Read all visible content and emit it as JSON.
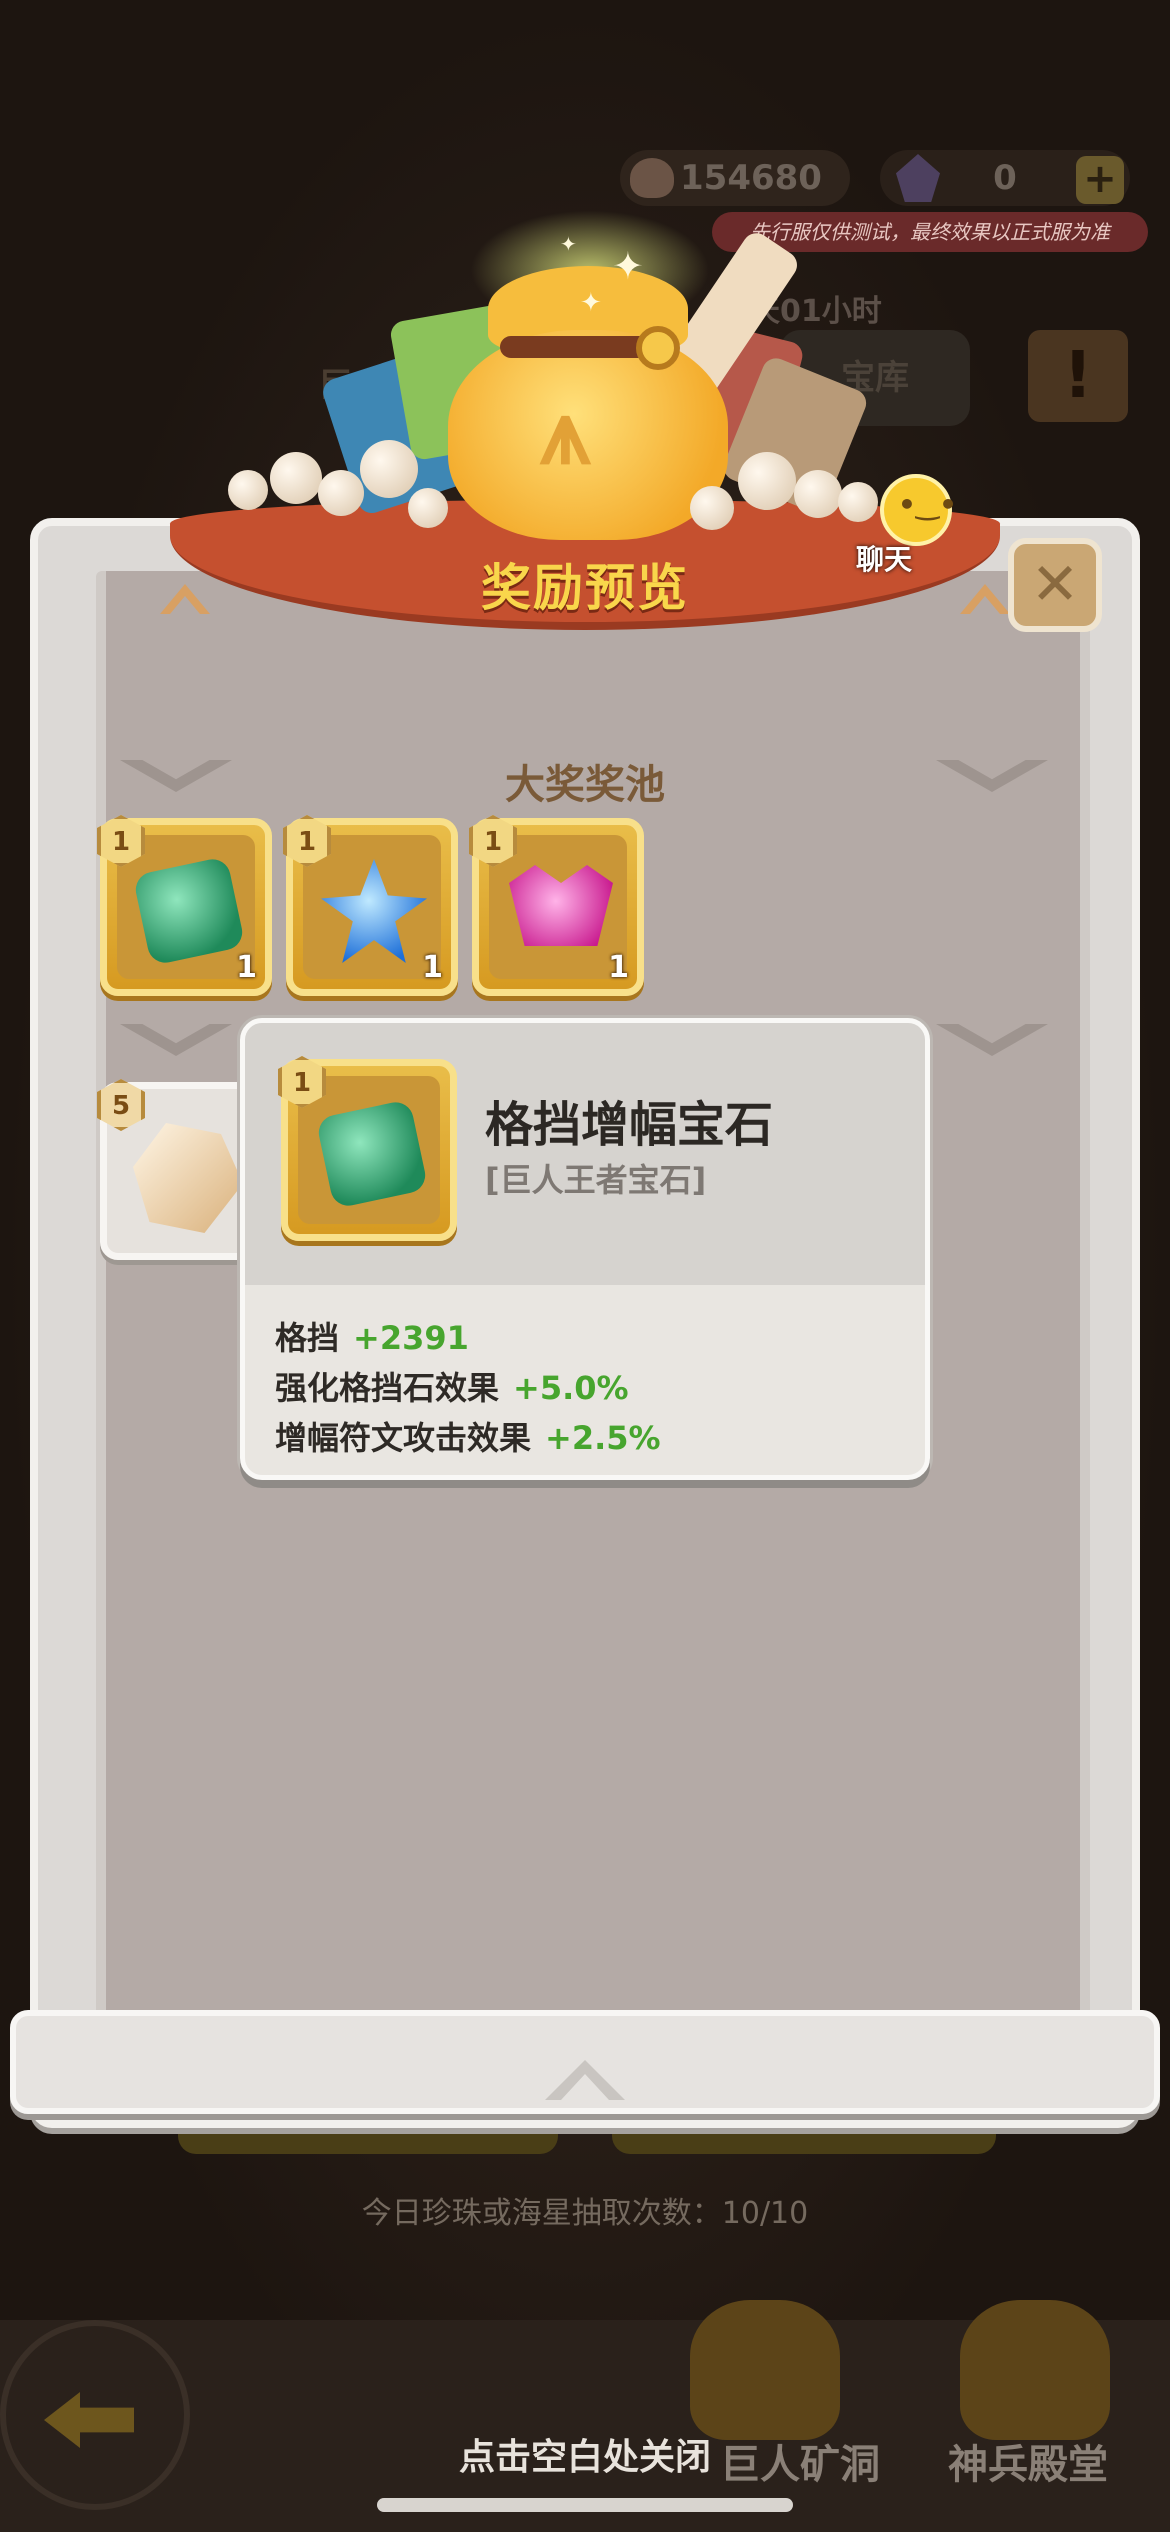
{
  "top": {
    "coins": "154680",
    "gems": "0",
    "plus": "+",
    "test_notice": "先行服仅供测试，最终效果以正式服为准",
    "timer_partial": "天01小时",
    "bg_title_partial": "巨人",
    "bg_button_partial": "宝库"
  },
  "modal": {
    "title": "奖励预览",
    "close_label": "✕",
    "pool_header": "大奖奖池",
    "items": [
      {
        "name": "绿色宝石",
        "badge": "1",
        "qty": "1",
        "icon": "green-gem-icon"
      },
      {
        "name": "蓝色宝石",
        "badge": "1",
        "qty": "1",
        "icon": "blue-star-gem-icon"
      },
      {
        "name": "粉色宝石",
        "badge": "1",
        "qty": "1",
        "icon": "pink-crown-gem-icon"
      }
    ],
    "second_row_badge": "5",
    "second_row_icon": "rock-ore-icon"
  },
  "tooltip": {
    "badge": "1",
    "name": "格挡增幅宝石",
    "subtitle": "[巨人王者宝石]",
    "stats": [
      {
        "label": "格挡",
        "value": "+2391"
      },
      {
        "label": "强化格挡石效果",
        "value": "+5.0%"
      },
      {
        "label": "增幅符文攻击效果",
        "value": "+2.5%"
      }
    ]
  },
  "chat": {
    "label": "聊天"
  },
  "background": {
    "draw_count": "今日珍珠或海星抽取次数：10/10",
    "tab_mine": "巨人矿洞",
    "tab_hall": "神兵殿堂",
    "notice_icon": "!"
  },
  "close_hint": "点击空白处关闭",
  "colors": {
    "gold_slot": "#e9bd49",
    "stat_green": "#47a52e",
    "banner_red": "#c5502f",
    "title_yellow": "#f9d64b"
  }
}
